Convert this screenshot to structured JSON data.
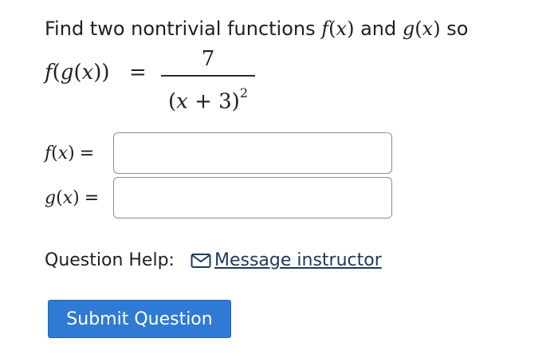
{
  "question": {
    "text_before": "Find two nontrivial functions",
    "f_name": "f",
    "g_name": "g",
    "variable": "x",
    "text_and": "and",
    "text_after": "so"
  },
  "equation": {
    "lhs_outer": "f",
    "lhs_inner": "g",
    "variable": "x",
    "sign": "=",
    "numerator": "7",
    "denominator_left": "(",
    "denominator_var": "x",
    "denominator_mid": " + 3)",
    "denominator_exponent": "2"
  },
  "answers": [
    {
      "func": "f",
      "variable": "x",
      "equals": "=",
      "value": ""
    },
    {
      "func": "g",
      "variable": "x",
      "equals": "=",
      "value": ""
    }
  ],
  "help": {
    "label": "Question Help:",
    "link_text": "Message instructor",
    "icon": "envelope-icon"
  },
  "submit": {
    "label": "Submit Question",
    "color": "#2f7ad5"
  }
}
